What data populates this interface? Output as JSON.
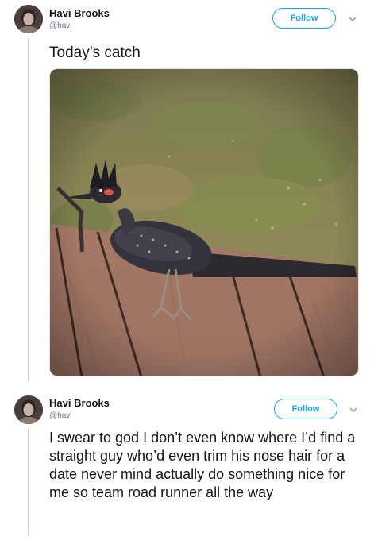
{
  "tweets": [
    {
      "author_name": "Havi Brooks",
      "author_handle": "@havi",
      "follow_label": "Follow",
      "text": "Today’s catch",
      "has_photo": true
    },
    {
      "author_name": "Havi Brooks",
      "author_handle": "@havi",
      "follow_label": "Follow",
      "text": "I swear to god I don’t even know where I’d find a straight guy who’d even trim his nose hair for a date never mind actually do something nice for me so team road runner all the way",
      "has_photo": false
    }
  ],
  "icons": {
    "avatar": "avatar-photo",
    "menu": "chevron-down-icon"
  },
  "colors": {
    "accent": "#1da1f2",
    "text": "#14171a",
    "secondary_text": "#657786",
    "thread_line": "#c4cfd6"
  }
}
